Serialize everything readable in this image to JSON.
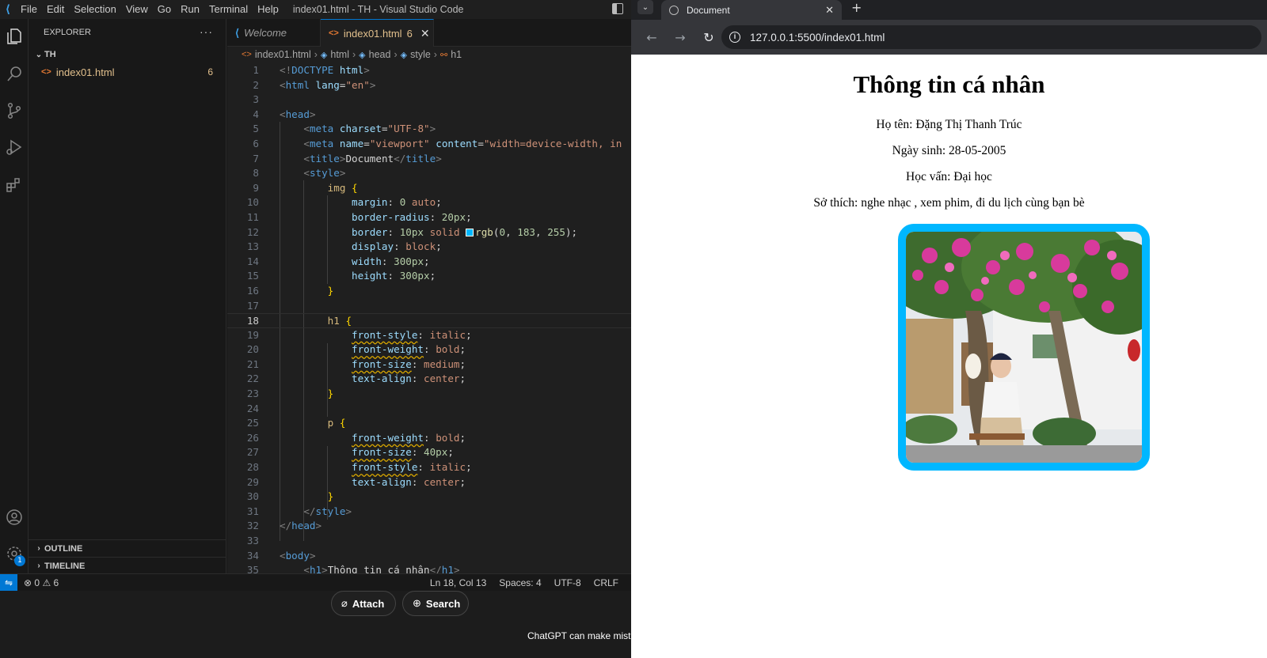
{
  "vscode": {
    "menu": [
      "File",
      "Edit",
      "Selection",
      "View",
      "Go",
      "Run",
      "Terminal",
      "Help"
    ],
    "window_title": "index01.html - TH - Visual Studio Code",
    "explorer": {
      "title": "EXPLORER",
      "folder": "TH",
      "file": "index01.html",
      "file_problems": "6",
      "outline": "OUTLINE",
      "timeline": "TIMELINE"
    },
    "settings_badge": "1",
    "tabs": [
      {
        "label": "Welcome"
      },
      {
        "label": "index01.html",
        "count": "6"
      }
    ],
    "breadcrumb": [
      "index01.html",
      "html",
      "head",
      "style",
      "h1"
    ],
    "status": {
      "errors": "0",
      "warnings": "6",
      "position": "Ln 18, Col 13",
      "spaces": "Spaces: 4",
      "encoding": "UTF-8",
      "eol": "CRLF"
    },
    "chat": {
      "attach": "Attach",
      "search": "Search",
      "disclaimer": "ChatGPT can make mista"
    }
  },
  "browser": {
    "tab_title": "Document",
    "url": "127.0.0.1:5500/index01.html",
    "page": {
      "heading": "Thông tin cá nhân",
      "name": "Họ tên: Đặng Thị Thanh Trúc",
      "dob": "Ngày sinh: 28-05-2005",
      "education": "Học vấn: Đại học",
      "hobbies": "Sở thích: nghe nhạc , xem phim, đi du lịch cùng bạn bè"
    }
  }
}
